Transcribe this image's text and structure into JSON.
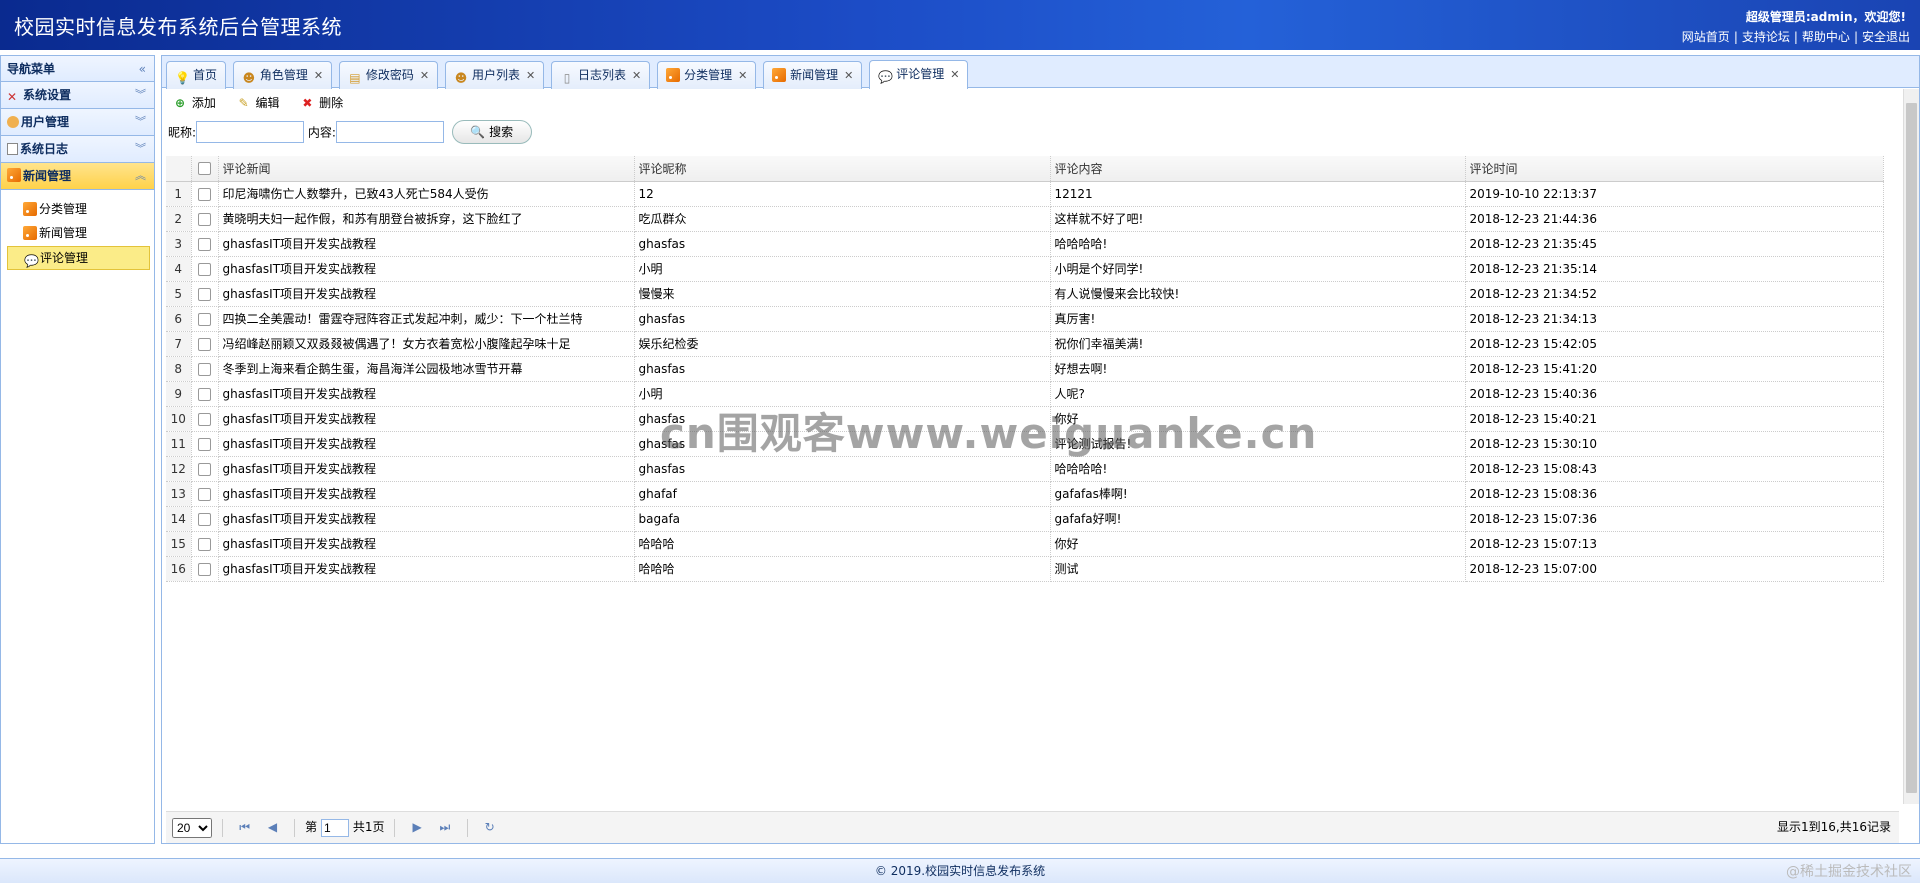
{
  "header": {
    "title": "校园实时信息发布系统后台管理系统",
    "welcome": "超级管理员:admin，欢迎您!",
    "links": [
      "网站首页",
      "支持论坛",
      "帮助中心",
      "安全退出"
    ]
  },
  "nav": {
    "title": "导航菜单",
    "groups": [
      {
        "label": "系统设置"
      },
      {
        "label": "用户管理"
      },
      {
        "label": "系统日志"
      },
      {
        "label": "新闻管理"
      }
    ],
    "items": [
      "分类管理",
      "新闻管理",
      "评论管理"
    ]
  },
  "tabs": [
    "首页",
    "角色管理",
    "修改密码",
    "用户列表",
    "日志列表",
    "分类管理",
    "新闻管理",
    "评论管理"
  ],
  "toolbar": {
    "add": "添加",
    "edit": "编辑",
    "delete": "删除"
  },
  "search": {
    "nick_label": "昵称:",
    "content_label": "内容:",
    "button": "搜索"
  },
  "grid": {
    "columns": [
      "评论新闻",
      "评论昵称",
      "评论内容",
      "评论时间"
    ],
    "rows": [
      [
        "1",
        "印尼海啸伤亡人数攀升，已致43人死亡584人受伤",
        "12",
        "12121",
        "2019-10-10 22:13:37"
      ],
      [
        "2",
        "黄晓明夫妇一起作假，和苏有朋登台被拆穿，这下脸红了",
        "吃瓜群众",
        "这样就不好了吧!",
        "2018-12-23 21:44:36"
      ],
      [
        "3",
        "ghasfasIT项目开发实战教程",
        "ghasfas",
        "哈哈哈哈!",
        "2018-12-23 21:35:45"
      ],
      [
        "4",
        "ghasfasIT项目开发实战教程",
        "小明",
        "小明是个好同学!",
        "2018-12-23 21:35:14"
      ],
      [
        "5",
        "ghasfasIT项目开发实战教程",
        "慢慢来",
        "有人说慢慢来会比较快!",
        "2018-12-23 21:34:52"
      ],
      [
        "6",
        "四换二全美震动！雷霆夺冠阵容正式发起冲刺，威少：下一个杜兰特",
        "ghasfas",
        "真厉害!",
        "2018-12-23 21:34:13"
      ],
      [
        "7",
        "冯绍峰赵丽颖又双叒叕被偶遇了！女方衣着宽松小腹隆起孕味十足",
        "娱乐纪检委",
        "祝你们幸福美满!",
        "2018-12-23 15:42:05"
      ],
      [
        "8",
        "冬季到上海来看企鹅生蛋，海昌海洋公园极地冰雪节开幕",
        "ghasfas",
        "好想去啊!",
        "2018-12-23 15:41:20"
      ],
      [
        "9",
        "ghasfasIT项目开发实战教程",
        "小明",
        "人呢?",
        "2018-12-23 15:40:36"
      ],
      [
        "10",
        "ghasfasIT项目开发实战教程",
        "ghasfas",
        "你好",
        "2018-12-23 15:40:21"
      ],
      [
        "11",
        "ghasfasIT项目开发实战教程",
        "ghasfas",
        "评论测试报告!",
        "2018-12-23 15:30:10"
      ],
      [
        "12",
        "ghasfasIT项目开发实战教程",
        "ghasfas",
        "哈哈哈哈!",
        "2018-12-23 15:08:43"
      ],
      [
        "13",
        "ghasfasIT项目开发实战教程",
        "ghafaf",
        "gafafas棒啊!",
        "2018-12-23 15:08:36"
      ],
      [
        "14",
        "ghasfasIT项目开发实战教程",
        "bagafa",
        "gafafa好啊!",
        "2018-12-23 15:07:36"
      ],
      [
        "15",
        "ghasfasIT项目开发实战教程",
        "哈哈哈",
        "你好",
        "2018-12-23 15:07:13"
      ],
      [
        "16",
        "ghasfasIT项目开发实战教程",
        "哈哈哈",
        "测试",
        "2018-12-23 15:07:00"
      ]
    ]
  },
  "pager": {
    "page_size": "20",
    "page_prefix": "第",
    "page_value": "1",
    "page_total": "共1页",
    "info": "显示1到16,共16记录"
  },
  "footer": "© 2019.校园实时信息发布系统",
  "watermark": "cn围观客www.weiguanke.cn",
  "juejin": "@稀土掘金技术社区"
}
